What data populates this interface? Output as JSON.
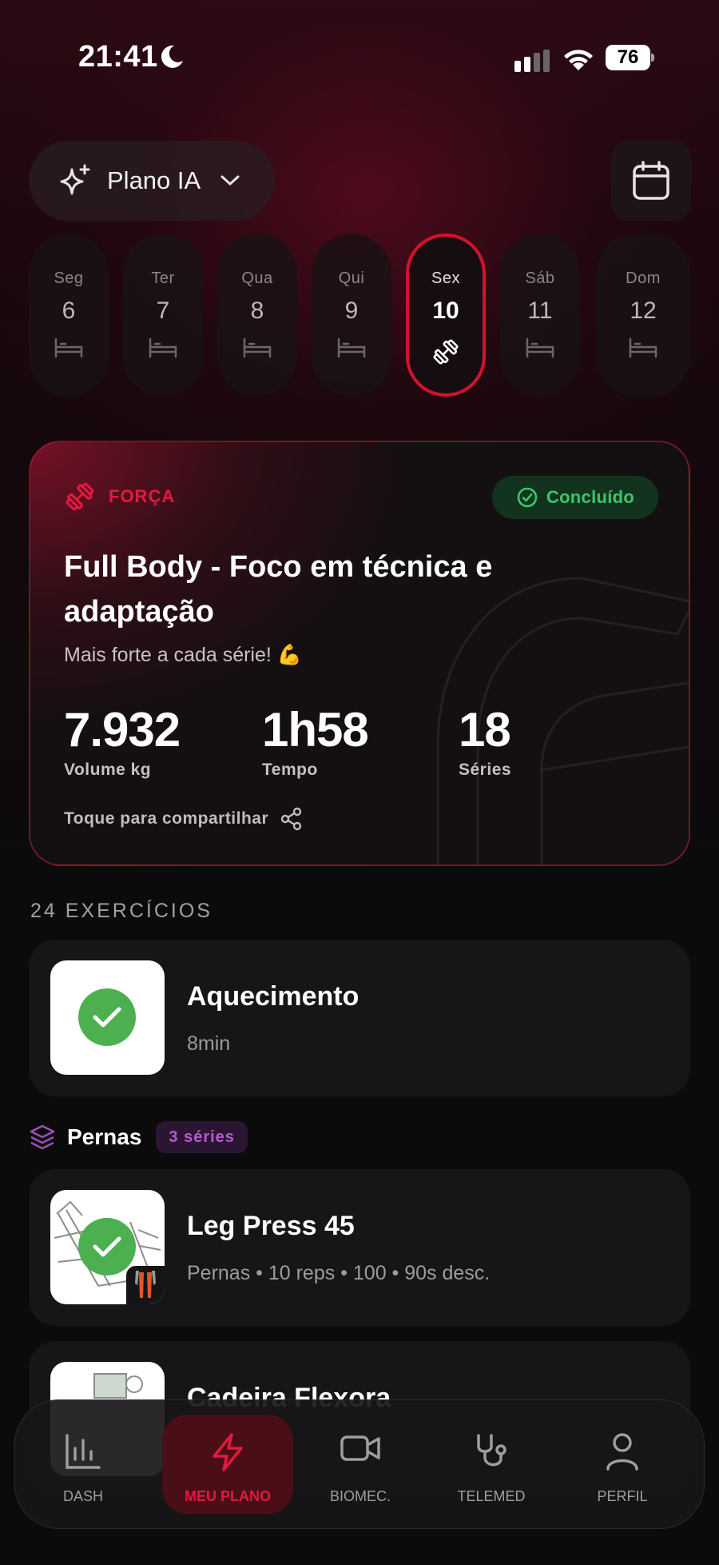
{
  "status_bar": {
    "time": "21:41",
    "battery": "76"
  },
  "header": {
    "plan_label": "Plano IA"
  },
  "week": [
    {
      "name": "Seg",
      "num": "6",
      "icon": "bed-icon",
      "active": false
    },
    {
      "name": "Ter",
      "num": "7",
      "icon": "bed-icon",
      "active": false
    },
    {
      "name": "Qua",
      "num": "8",
      "icon": "bed-icon",
      "active": false
    },
    {
      "name": "Qui",
      "num": "9",
      "icon": "bed-icon",
      "active": false
    },
    {
      "name": "Sex",
      "num": "10",
      "icon": "dumbbell-icon",
      "active": true
    },
    {
      "name": "Sáb",
      "num": "11",
      "icon": "bed-icon",
      "active": false
    },
    {
      "name": "Dom",
      "num": "12",
      "icon": "bed-icon",
      "active": false
    }
  ],
  "workout": {
    "category": "FORÇA",
    "status": "Concluído",
    "title": "Full Body - Foco em técnica e adaptação",
    "subtitle": "Mais forte a cada série! 💪",
    "stats": [
      {
        "value": "7.932",
        "label": "Volume kg"
      },
      {
        "value": "1h58",
        "label": "Tempo"
      },
      {
        "value": "18",
        "label": "Séries"
      }
    ],
    "share_label": "Toque para compartilhar"
  },
  "exercise_count": "24 EXERCÍCIOS",
  "warmup": {
    "title": "Aquecimento",
    "sub": "8min"
  },
  "group": {
    "name": "Pernas",
    "badge": "3 séries"
  },
  "exercises": [
    {
      "title": "Leg Press 45",
      "sub": "Pernas • 10 reps • 100 • 90s desc."
    },
    {
      "title": "Cadeira Flexora",
      "sub": ""
    }
  ],
  "nav": [
    {
      "label": "DASH",
      "icon": "bar-chart-icon",
      "active": false
    },
    {
      "label": "MEU PLANO",
      "icon": "lightning-icon",
      "active": true
    },
    {
      "label": "BIOMEC.",
      "icon": "video-camera-icon",
      "active": false
    },
    {
      "label": "TELEMED",
      "icon": "stethoscope-icon",
      "active": false
    },
    {
      "label": "PERFIL",
      "icon": "user-icon",
      "active": false
    }
  ],
  "colors": {
    "accent": "#e3193f",
    "success": "#3ec56a",
    "check": "#4caf50",
    "series_badge": "#b85ad1"
  }
}
